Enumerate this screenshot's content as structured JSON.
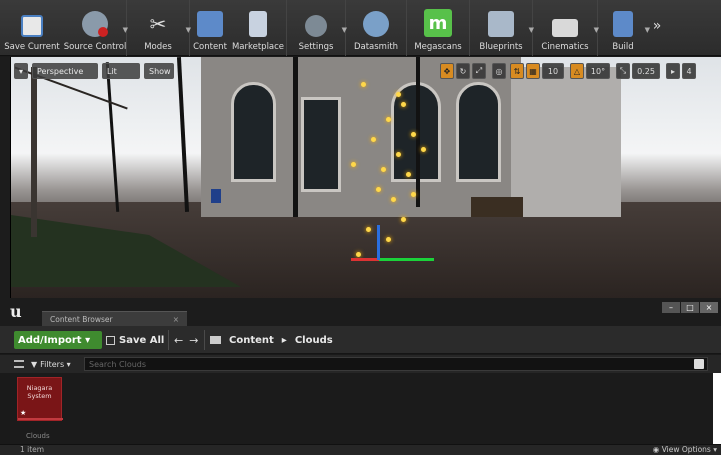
{
  "toolbar": {
    "buttons": [
      {
        "label": "Save Current",
        "icon": "save-icon"
      },
      {
        "label": "Source Control",
        "icon": "source-control-icon"
      },
      {
        "label": "Modes",
        "icon": "modes-icon"
      },
      {
        "label": "Content",
        "icon": "content-icon"
      },
      {
        "label": "Marketplace",
        "icon": "marketplace-icon"
      },
      {
        "label": "Settings",
        "icon": "settings-icon"
      },
      {
        "label": "Datasmith",
        "icon": "datasmith-icon"
      },
      {
        "label": "Megascans",
        "icon": "megascans-icon"
      },
      {
        "label": "Blueprints",
        "icon": "blueprints-icon"
      },
      {
        "label": "Cinematics",
        "icon": "cinematics-icon"
      },
      {
        "label": "Build",
        "icon": "build-icon"
      }
    ],
    "megascans_glyph": "m",
    "more": "»"
  },
  "viewport": {
    "menu_caret": "▾",
    "perspective": "Perspective",
    "lit": "Lit",
    "show": "Show",
    "grid_snap": "10",
    "rot_snap": "10°",
    "scale_snap": "0.25",
    "camera_speed": "4"
  },
  "content_browser": {
    "logo": "u",
    "tab_label": "Content Browser",
    "tab_close": "×",
    "add_import": "Add/Import ▾",
    "save_all": "Save All",
    "back": "←",
    "forward": "→",
    "path": [
      "Content",
      "Clouds"
    ],
    "path_sep": "▸",
    "filters": "Filters ▾",
    "search_placeholder": "Search Clouds",
    "asset": {
      "name": "Niagara System",
      "star": "★"
    },
    "folder_label": "Clouds",
    "items_count": "1 item",
    "view_options": "View Options ▾"
  },
  "window_controls": {
    "minimize": "–",
    "maximize": "□",
    "close": "×"
  },
  "colors": {
    "accent_green": "#3f8b2f",
    "niagara_red": "#7a1517",
    "snap_orange": "#d88b21"
  }
}
